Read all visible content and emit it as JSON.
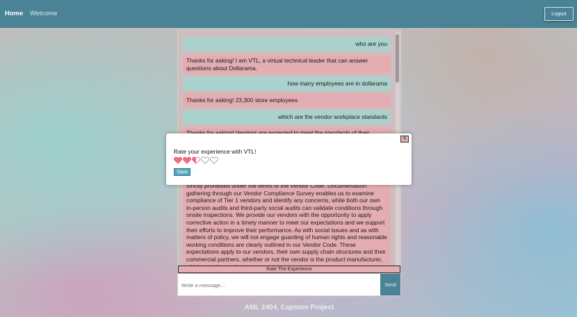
{
  "nav": {
    "home": "Home",
    "welcome": "Welcome",
    "logout": "Logout"
  },
  "chat": {
    "messages": [
      {
        "role": "user",
        "text": "who are you"
      },
      {
        "role": "bot",
        "text": "Thanks for asking! I am VTL, a virtual technical leader that can answer questions about Dollarama."
      },
      {
        "role": "user",
        "text": "how many employees are in dollarama"
      },
      {
        "role": "bot",
        "text": "Thanks for asking! 23,300 store employees"
      },
      {
        "role": "user",
        "text": "which are the vendor workplace standards"
      },
      {
        "role": "bot",
        "text": "Thanks for asking! Vendors are expected to meet the standards of their"
      },
      {
        "role": "bot",
        "text": "strictly prohibited under the terms of the Vendor Code. Documentation gathering through our Vendor Compliance Survey enables us to examine compliance of Tier 1 vendors and identify any concerns, while both our own in-person audits and third-party social audits can validate conditions through onsite inspections. We provide our vendors with the opportunity to apply corrective action in a timely manner to meet our expectations and we support their efforts to improve their performance. As with social issues and as with matters of policy, we will not engage guarding of human rights and reasonable working conditions are clearly outlined in our Vendor Code. These expectations apply to our vendors, their own supply chain structures and their commercial partners, whether or not the vendor is the product manufacturer, which must be made transparent to"
      }
    ],
    "rate_button": "Rate The Experience",
    "input_placeholder": "Write a message...",
    "send_label": "Send"
  },
  "footer": "AML 2404, Capston Project",
  "modal": {
    "close_label": "X",
    "title": "Rate your experience with VTL!",
    "rating": 2.5,
    "max_rating": 5,
    "save_label": "Save"
  },
  "colors": {
    "accent": "#4a8396",
    "user_bubble": "#a9d2cd",
    "bot_bubble": "#e4adb2",
    "heart": "#f06c7e"
  }
}
